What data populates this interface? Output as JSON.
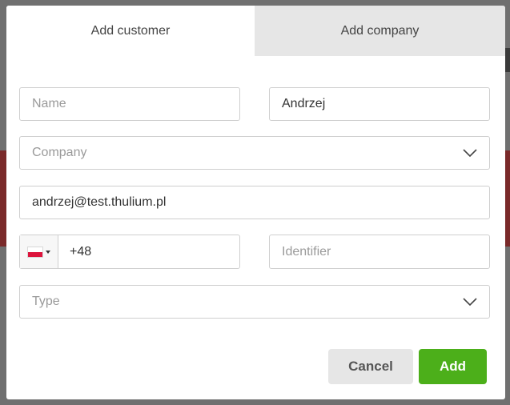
{
  "tabs": {
    "customer": "Add customer",
    "company": "Add company"
  },
  "form": {
    "name": {
      "placeholder": "Name",
      "value": ""
    },
    "surname": {
      "placeholder": "",
      "value": "Andrzej"
    },
    "company": {
      "placeholder": "Company"
    },
    "email": {
      "placeholder": "",
      "value": "andrzej@test.thulium.pl"
    },
    "phone": {
      "country": "PL",
      "value": "+48"
    },
    "identifier": {
      "placeholder": "Identifier",
      "value": ""
    },
    "type": {
      "placeholder": "Type"
    }
  },
  "buttons": {
    "cancel": "Cancel",
    "add": "Add"
  },
  "colors": {
    "accent_green": "#4caf1a",
    "inactive_tab": "#e6e6e6",
    "cancel_bg": "#e6e6e6",
    "border": "#cfcfcf"
  },
  "icons": {
    "flag": "poland-flag-icon",
    "caret": "caret-down-icon",
    "chevron": "chevron-down-icon"
  }
}
